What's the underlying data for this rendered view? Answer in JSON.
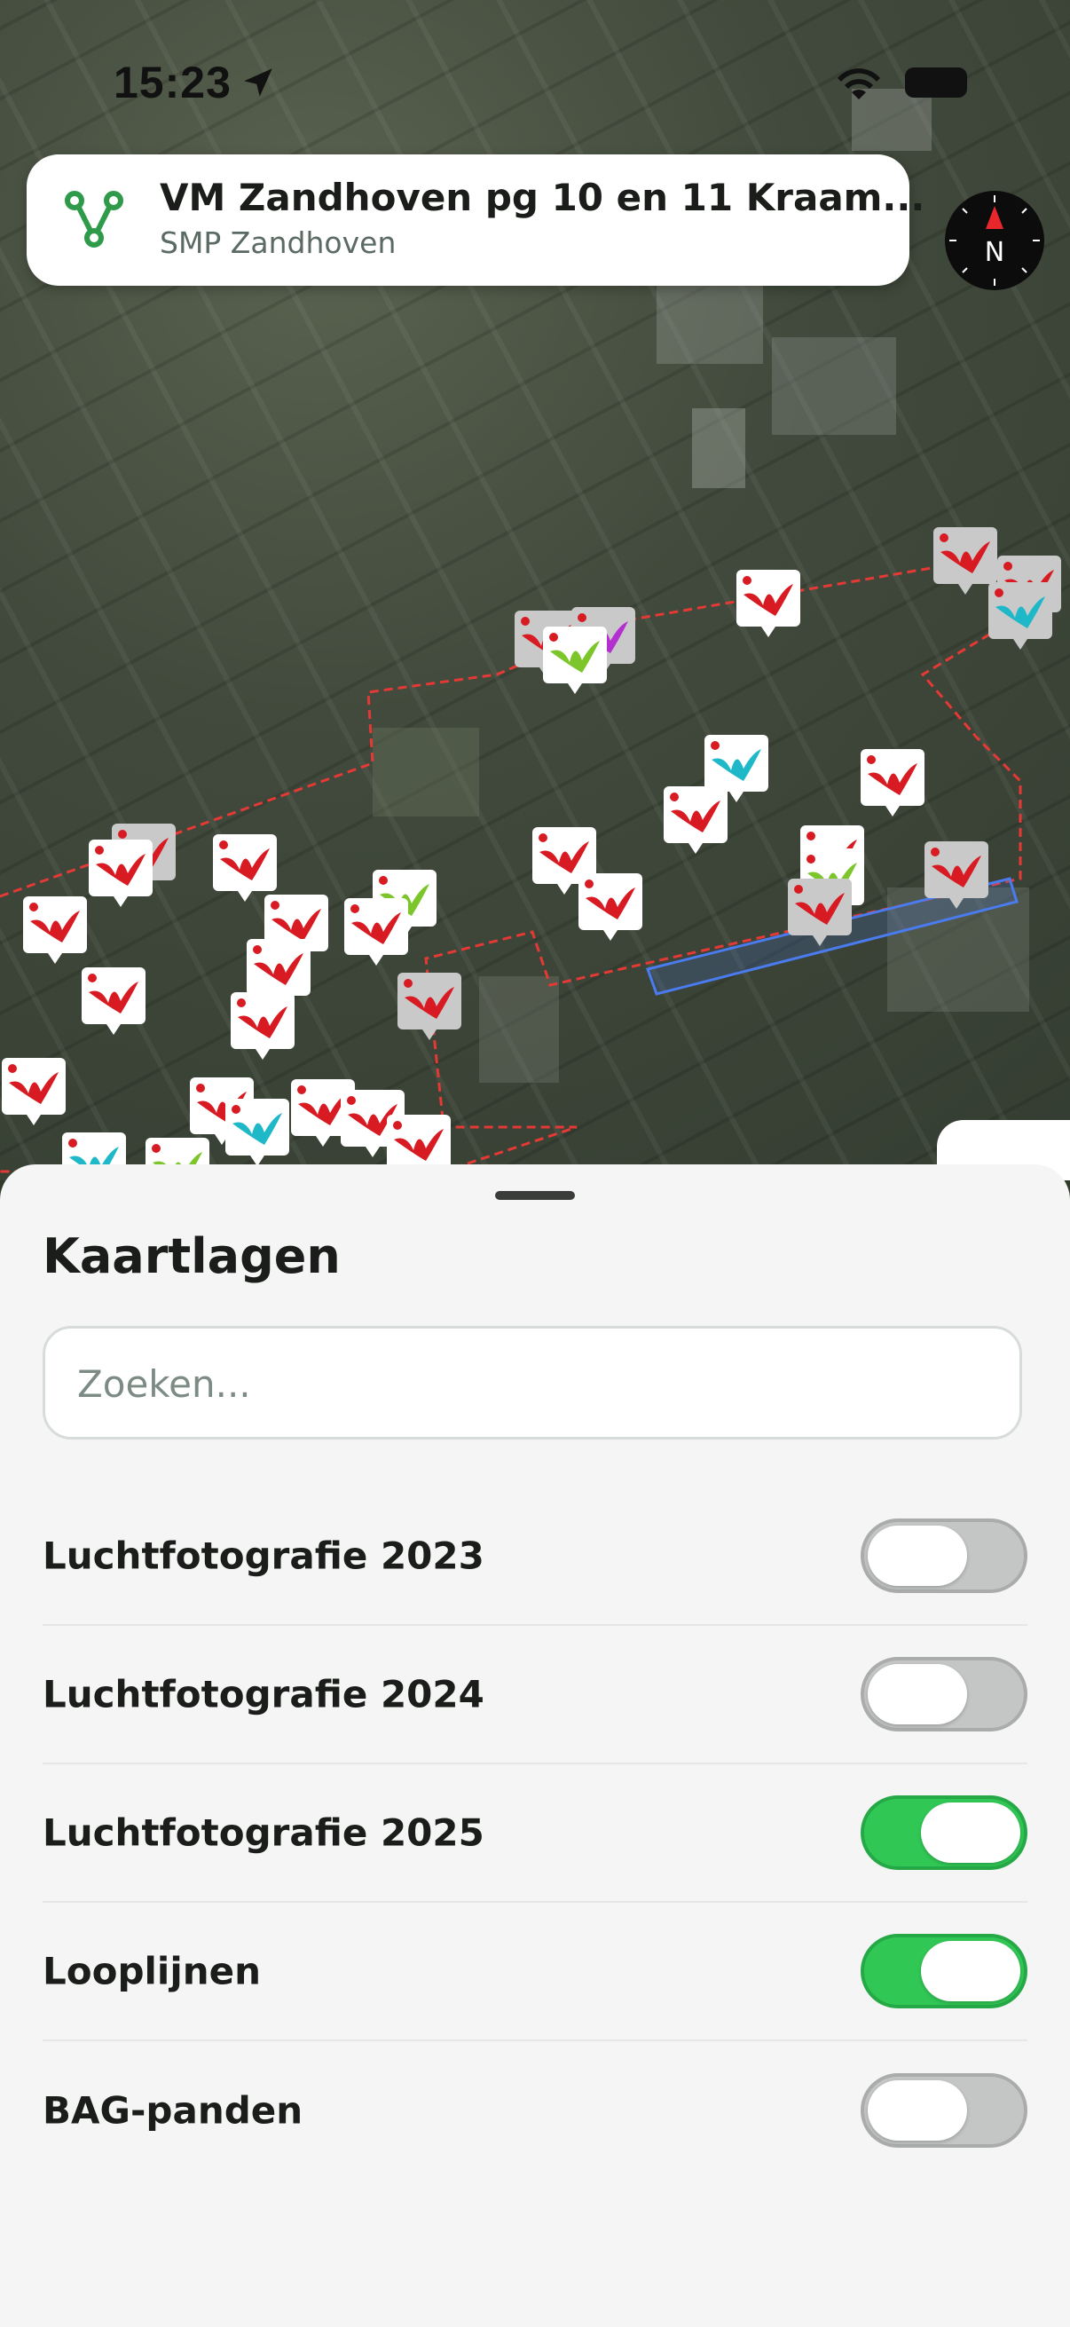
{
  "status_bar": {
    "time": "15:23"
  },
  "project": {
    "title": "VM Zandhoven pg 10 en 11 Kraam...",
    "subtitle": "SMP Zandhoven",
    "icon": "route-icon"
  },
  "compass": {
    "label": "N"
  },
  "map": {
    "marker_icons": [
      "bat-icon",
      "bug-icon",
      "house-icon",
      "bird-icon"
    ],
    "colors": {
      "area_outline": "#e53935",
      "selection_outline": "#4a7cf0",
      "marker_red": "#d81b22",
      "marker_cyan": "#1fb8c8",
      "marker_green": "#7cc62b",
      "marker_purple": "#b42fd0"
    }
  },
  "sheet": {
    "title": "Kaartlagen",
    "search_placeholder": "Zoeken...",
    "layers": [
      {
        "label": "Luchtfotografie 2023",
        "enabled": false
      },
      {
        "label": "Luchtfotografie 2024",
        "enabled": false
      },
      {
        "label": "Luchtfotografie 2025",
        "enabled": true
      },
      {
        "label": "Looplijnen",
        "enabled": true
      },
      {
        "label": "BAG-panden",
        "enabled": false
      }
    ],
    "colors": {
      "toggle_on": "#31c755",
      "toggle_off": "#c4c6c6"
    }
  }
}
